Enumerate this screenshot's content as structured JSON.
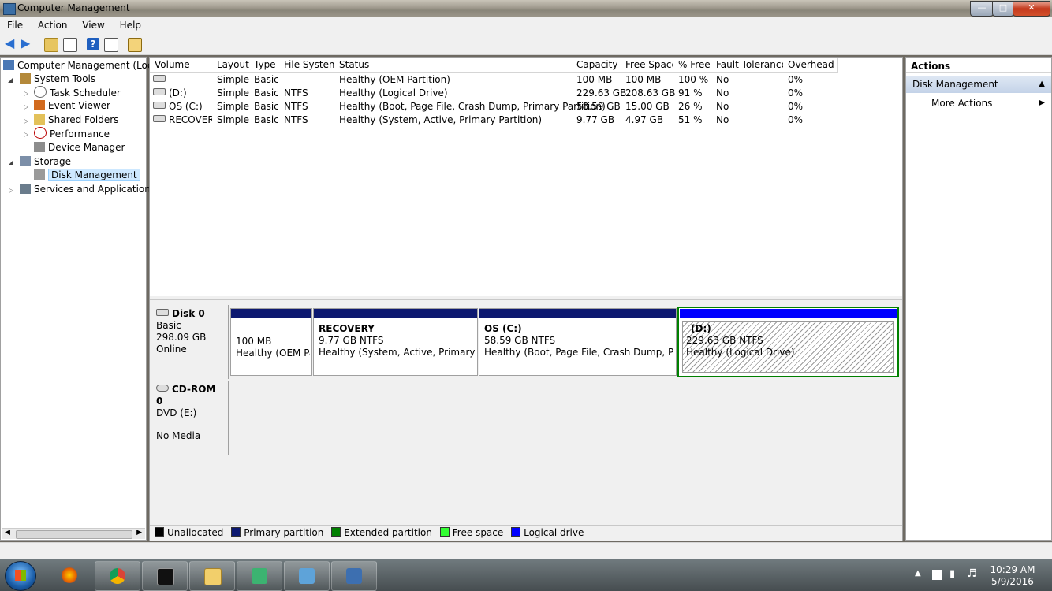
{
  "window": {
    "title": "Computer Management"
  },
  "menubar": {
    "items": [
      "File",
      "Action",
      "View",
      "Help"
    ]
  },
  "toolbar": {
    "icons": [
      "back-arrow-icon",
      "forward-arrow-icon",
      "up-folder-icon",
      "show-hide-tree-icon",
      "help-icon",
      "show-hide-action-pane-icon",
      "properties-icon"
    ]
  },
  "tree": {
    "root": "Computer Management (Local",
    "system_tools": "System Tools",
    "task_scheduler": "Task Scheduler",
    "event_viewer": "Event Viewer",
    "shared_folders": "Shared Folders",
    "performance": "Performance",
    "device_manager": "Device Manager",
    "storage": "Storage",
    "disk_management": "Disk Management",
    "services": "Services and Applications"
  },
  "volumes": {
    "headers": [
      "Volume",
      "Layout",
      "Type",
      "File System",
      "Status",
      "Capacity",
      "Free Space",
      "% Free",
      "Fault Tolerance",
      "Overhead"
    ],
    "rows": [
      [
        "",
        "Simple",
        "Basic",
        "",
        "Healthy (OEM Partition)",
        "100 MB",
        "100 MB",
        "100 %",
        "No",
        "0%"
      ],
      [
        "(D:)",
        "Simple",
        "Basic",
        "NTFS",
        "Healthy (Logical Drive)",
        "229.63 GB",
        "208.63 GB",
        "91 %",
        "No",
        "0%"
      ],
      [
        "OS (C:)",
        "Simple",
        "Basic",
        "NTFS",
        "Healthy (Boot, Page File, Crash Dump, Primary Partition)",
        "58.59 GB",
        "15.00 GB",
        "26 %",
        "No",
        "0%"
      ],
      [
        "RECOVERY",
        "Simple",
        "Basic",
        "NTFS",
        "Healthy (System, Active, Primary Partition)",
        "9.77 GB",
        "4.97 GB",
        "51 %",
        "No",
        "0%"
      ]
    ]
  },
  "disks": {
    "disk0": {
      "name": "Disk 0",
      "type": "Basic",
      "size": "298.09 GB",
      "state": "Online"
    },
    "partitions": [
      {
        "name": "",
        "size": "100 MB",
        "status": "Healthy (OEM Pa"
      },
      {
        "name": "RECOVERY",
        "size": "9.77 GB NTFS",
        "status": "Healthy (System, Active, Primary Parti"
      },
      {
        "name": "OS  (C:)",
        "size": "58.59 GB NTFS",
        "status": "Healthy (Boot, Page File, Crash Dump, Primar"
      },
      {
        "name": "(D:)",
        "size": "229.63 GB NTFS",
        "status": "Healthy (Logical Drive)"
      }
    ],
    "cdrom": {
      "name": "CD-ROM 0",
      "type": "DVD (E:)",
      "media": "No Media"
    }
  },
  "legend": [
    {
      "label": "Unallocated",
      "color": "#000000"
    },
    {
      "label": "Primary partition",
      "color": "#0c1870"
    },
    {
      "label": "Extended partition",
      "color": "#008000"
    },
    {
      "label": "Free space",
      "color": "#33ff33"
    },
    {
      "label": "Logical drive",
      "color": "#0000ff"
    }
  ],
  "actions": {
    "header": "Actions",
    "section": "Disk Management",
    "more": "More Actions"
  },
  "taskbar": {
    "time": "10:29 AM",
    "date": "5/9/2016"
  },
  "colors": {
    "primary": "#0c1870",
    "logical": "#0000ff",
    "extended": "#008000",
    "selection": "#cde8ff"
  }
}
